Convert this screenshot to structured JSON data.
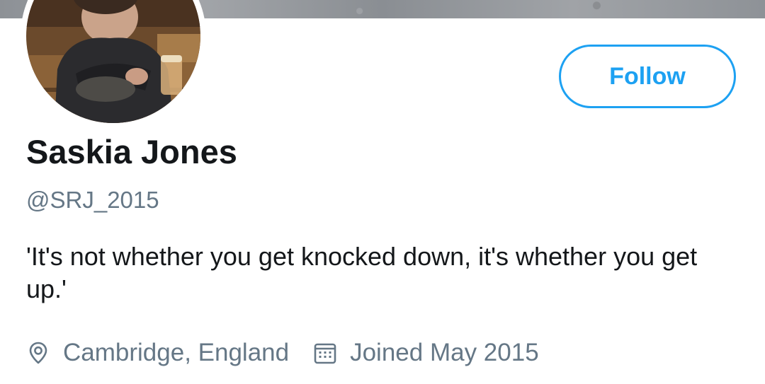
{
  "profile": {
    "display_name": "Saskia Jones",
    "handle": "@SRJ_2015",
    "bio": "'It's not whether you get knocked down, it's whether you get up.'",
    "location": "Cambridge, England",
    "joined": "Joined May 2015",
    "avatar_description": "profile photo",
    "banner_description": "header image"
  },
  "actions": {
    "follow_label": "Follow"
  },
  "icons": {
    "location": "location-pin-icon",
    "joined": "calendar-icon"
  },
  "colors": {
    "accent": "#1da1f2",
    "primary_text": "#14171a",
    "secondary_text": "#657786",
    "background": "#ffffff"
  }
}
